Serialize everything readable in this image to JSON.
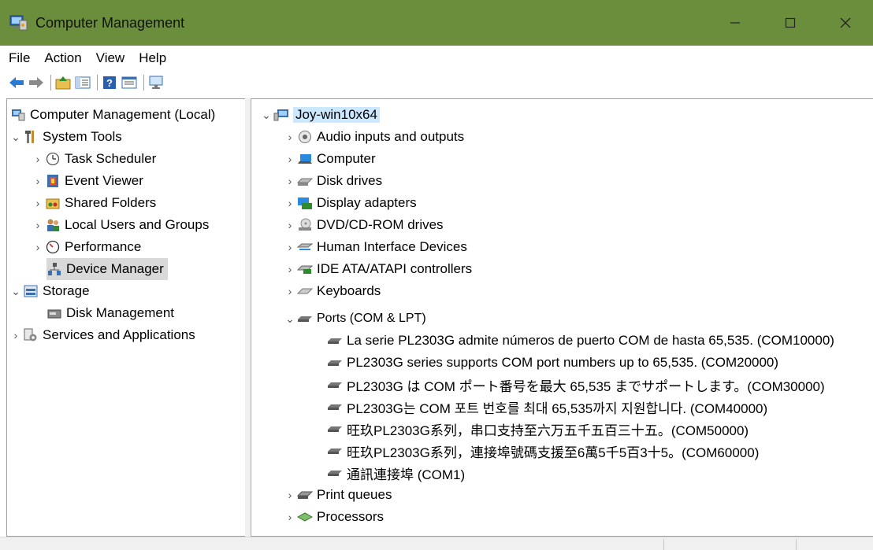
{
  "window": {
    "title": "Computer Management",
    "minimize": "—",
    "maximize": "☐",
    "close": "✕"
  },
  "menu": [
    "File",
    "Action",
    "View",
    "Help"
  ],
  "tree": {
    "root": "Computer Management (Local)",
    "system_tools": "System Tools",
    "task_scheduler": "Task Scheduler",
    "event_viewer": "Event Viewer",
    "shared_folders": "Shared Folders",
    "local_users": "Local Users and Groups",
    "performance": "Performance",
    "device_manager": "Device Manager",
    "storage": "Storage",
    "disk_management": "Disk Management",
    "services": "Services and Applications"
  },
  "devices": {
    "computer_name": "Joy-win10x64",
    "categories": [
      "Audio inputs and outputs",
      "Computer",
      "Disk drives",
      "Display adapters",
      "DVD/CD-ROM drives",
      "Human Interface Devices",
      "IDE ATA/ATAPI controllers",
      "Keyboards"
    ],
    "ports_label": "Ports (COM & LPT)",
    "ports": [
      "La serie PL2303G admite números de puerto COM de hasta 65,535. (COM10000)",
      "PL2303G series supports COM port numbers up to 65,535. (COM20000)",
      "PL2303G は COM ポート番号を最大 65,535 までサポートします。(COM30000)",
      "PL2303G는 COM 포트 번호를 최대 65,535까지 지원합니다. (COM40000)",
      "旺玖PL2303G系列，串口支持至六万五千五百三十五。(COM50000)",
      "旺玖PL2303G系列，連接埠號碼支援至6萬5千5百3十5。(COM60000)",
      "通訊連接埠 (COM1)"
    ],
    "after": [
      "Print queues",
      "Processors"
    ]
  }
}
